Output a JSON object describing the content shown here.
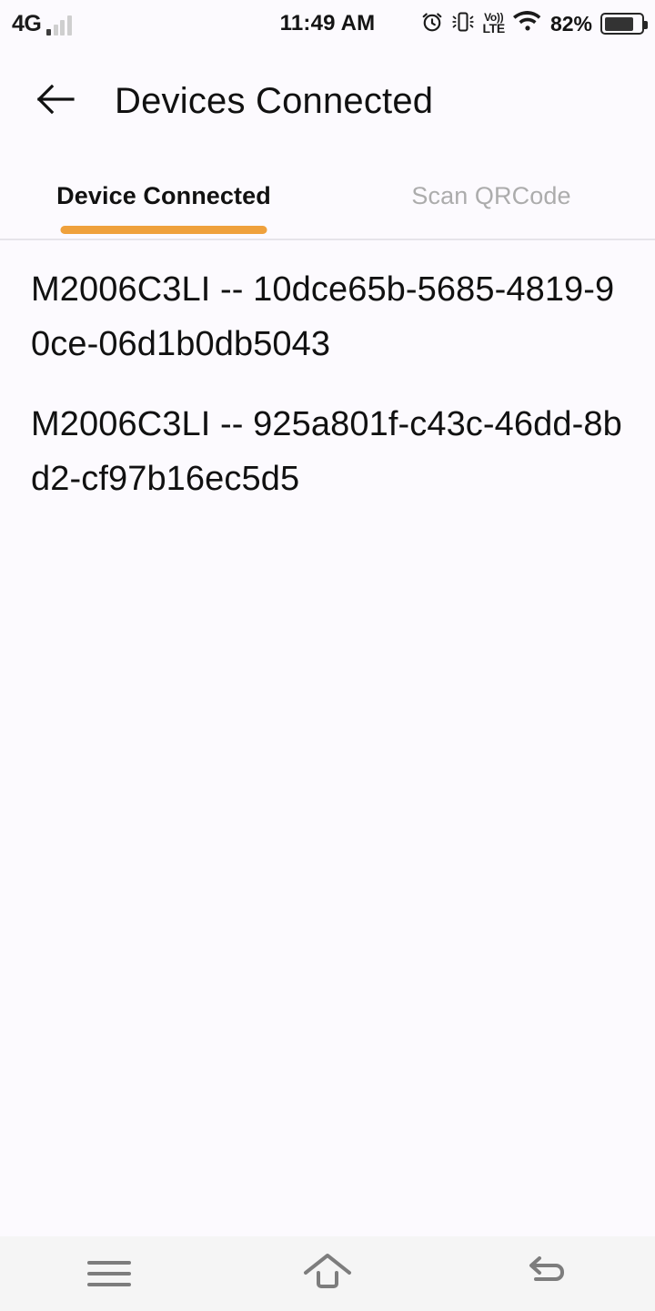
{
  "statusbar": {
    "network_type": "4G",
    "signal_icon": "signal-bars-icon",
    "clock": "11:49 AM",
    "alarm_icon": "alarm-clock-icon",
    "vibrate_icon": "vibrate-icon",
    "volte_top": "Vo))",
    "volte_bottom": "LTE",
    "wifi_icon": "wifi-icon",
    "battery_percent": "82%",
    "battery_icon": "battery-icon",
    "battery_level": 82
  },
  "appbar": {
    "back_icon": "arrow-left-icon",
    "title": "Devices Connected"
  },
  "tabs": {
    "active_index": 0,
    "indicator_color": "#EFA13C",
    "items": [
      {
        "label": "Device Connected",
        "active": true
      },
      {
        "label": "Scan QRCode",
        "active": false
      }
    ]
  },
  "device_list": {
    "items": [
      {
        "text": "M2006C3LI -- 10dce65b-5685-4819-90ce-06d1b0db5043"
      },
      {
        "text": "M2006C3LI -- 925a801f-c43c-46dd-8bd2-cf97b16ec5d5"
      }
    ]
  },
  "navbar": {
    "menu_icon": "menu-icon",
    "home_icon": "home-icon",
    "back_icon": "back-arrow-icon"
  }
}
